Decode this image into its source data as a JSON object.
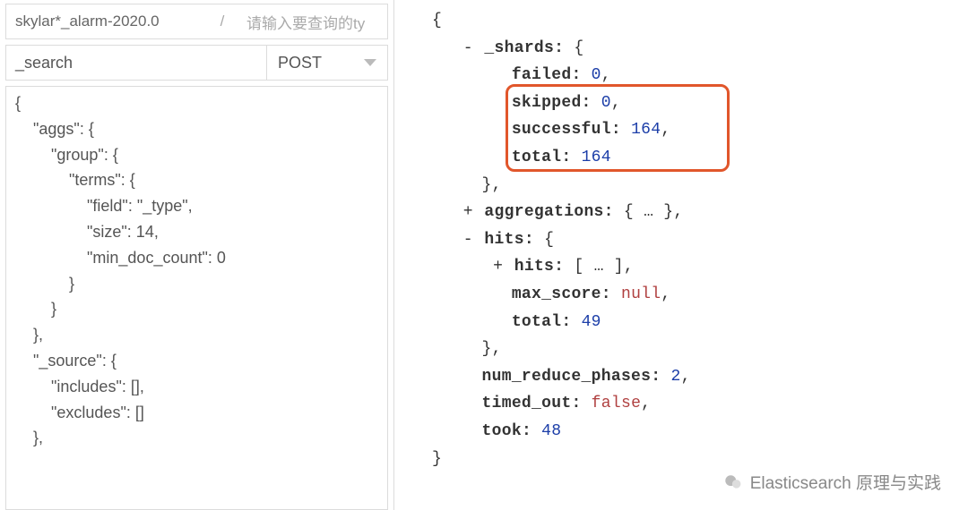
{
  "left": {
    "index_value": "skylar*_alarm-2020.0",
    "slash": "/",
    "type_placeholder": "请输入要查询的ty",
    "endpoint": "_search",
    "method": "POST",
    "body_lines": [
      "{",
      "    \"aggs\": {",
      "        \"group\": {",
      "            \"terms\": {",
      "                \"field\": \"_type\",",
      "                \"size\": 14,",
      "                \"min_doc_count\": 0",
      "            }",
      "        }",
      "    },",
      "    \"_source\": {",
      "        \"includes\": [],",
      "        \"excludes\": []",
      "    },"
    ]
  },
  "right": {
    "open": "{",
    "shards": {
      "label": "_shards",
      "open": "{",
      "toggle": "-",
      "failed_k": "failed",
      "failed_v": "0",
      "skipped_k": "skipped",
      "skipped_v": "0",
      "successful_k": "successful",
      "successful_v": "164",
      "total_k": "total",
      "total_v": "164",
      "close": "},"
    },
    "aggs": {
      "toggle": "+",
      "label": "aggregations",
      "body": "{ … },"
    },
    "hits": {
      "toggle": "-",
      "label": "hits",
      "open": "{",
      "inner_toggle": "+",
      "inner_label": "hits",
      "inner_body": "[ … ],",
      "max_k": "max_score",
      "max_v": "null",
      "total_k": "total",
      "total_v": "49",
      "close": "},"
    },
    "nrp_k": "num_reduce_phases",
    "nrp_v": "2",
    "to_k": "timed_out",
    "to_v": "false",
    "took_k": "took",
    "took_v": "48",
    "close": "}"
  },
  "watermark": "Elasticsearch 原理与实践"
}
